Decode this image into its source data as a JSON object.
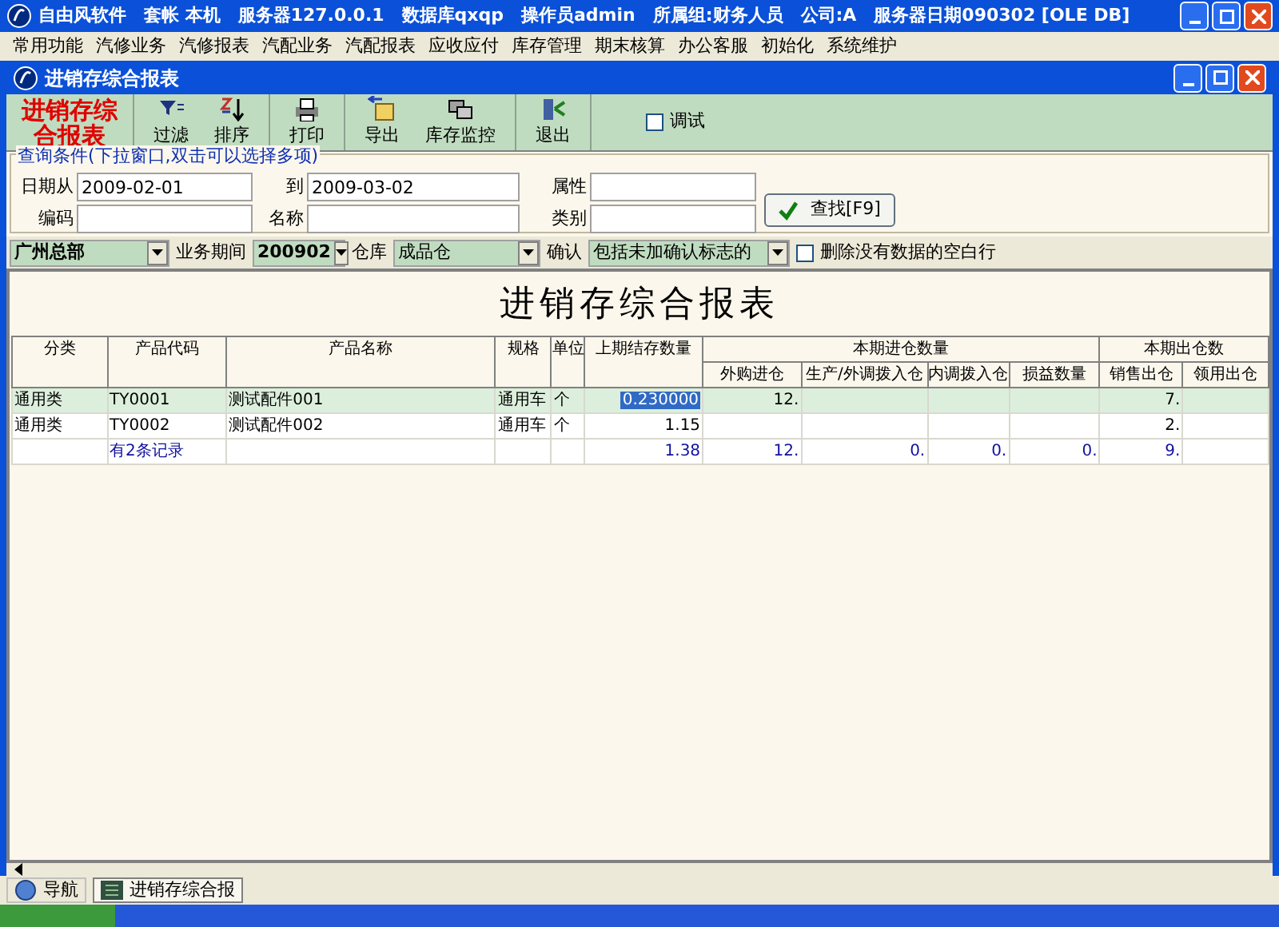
{
  "window": {
    "title": "自由风软件　套帐 本机　服务器127.0.0.1　数据库qxqp　操作员admin　所属组:财务人员　公司:A　服务器日期090302 [OLE DB]"
  },
  "menu": [
    "常用功能",
    "汽修业务",
    "汽修报表",
    "汽配业务",
    "汽配报表",
    "应收应付",
    "库存管理",
    "期末核算",
    "办公客服",
    "初始化",
    "系统维护"
  ],
  "child_window": {
    "title": "进销存综合报表"
  },
  "toolbar": {
    "title": "进销存综合报表",
    "buttons": [
      {
        "label": "过滤",
        "kind": "filter"
      },
      {
        "label": "排序",
        "kind": "sort"
      },
      {
        "label": "打印",
        "kind": "print"
      },
      {
        "label": "导出",
        "kind": "export"
      },
      {
        "label": "库存监控",
        "kind": "monitor"
      },
      {
        "label": "退出",
        "kind": "exit"
      }
    ],
    "debug": {
      "label": "调试",
      "checked": false
    }
  },
  "query": {
    "legend": "查询条件(下拉窗口,双击可以选择多项)",
    "fields": [
      {
        "label": "日期从",
        "value": "2009-02-01"
      },
      {
        "label": "到",
        "value": "2009-03-02"
      },
      {
        "label": "属性"
      },
      {
        "label": "编码"
      },
      {
        "label": "名称"
      },
      {
        "label": "类别"
      }
    ],
    "search_button": "查找[F9]"
  },
  "filters": {
    "branch": "广州总部",
    "period_label": "业务期间",
    "period": "200902",
    "warehouse_label": "仓库",
    "warehouse": "成品仓",
    "confirm_label": "确认",
    "confirm": "包括未加确认标志的",
    "remove_empty": {
      "label": "删除没有数据的空白行",
      "checked": false
    }
  },
  "report": {
    "title": "进销存综合报表",
    "headers": [
      {
        "label": "分类"
      },
      {
        "label": "产品代码"
      },
      {
        "label": "产品名称"
      },
      {
        "label": "规格"
      },
      {
        "label": "单位"
      },
      {
        "label": "上期结存数量"
      },
      {
        "group": "本期进仓数量",
        "subcolumns": [
          "外购进仓",
          "生产/外调拨入仓",
          "内调拨入仓",
          "损益数量"
        ]
      },
      {
        "group": "本期出仓数",
        "subcolumns": [
          "销售出仓",
          "领用出仓"
        ]
      }
    ],
    "rows": [
      {
        "kind": "item",
        "selected": true,
        "cells": [
          {
            "text": "通用类",
            "selected": false
          },
          {
            "text": "TY0001",
            "selected": false
          },
          {
            "text": "测试配件001",
            "selected": false
          },
          {
            "text": "通用车",
            "selected": false
          },
          {
            "text": "个",
            "selected": false
          },
          {
            "text": "0.230000",
            "selected": true
          },
          {
            "text": "12.",
            "selected": false
          },
          {
            "selected": false
          },
          {
            "selected": false
          },
          {
            "selected": false
          },
          {
            "text": "7.",
            "selected": false
          },
          {
            "selected": false
          }
        ]
      },
      {
        "kind": "item",
        "selected": false,
        "cells": [
          {
            "text": "通用类",
            "selected": false
          },
          {
            "text": "TY0002",
            "selected": false
          },
          {
            "text": "测试配件002",
            "selected": false
          },
          {
            "text": "通用车",
            "selected": false
          },
          {
            "text": "个",
            "selected": false
          },
          {
            "text": "1.15",
            "selected": false
          },
          {
            "selected": false
          },
          {
            "selected": false
          },
          {
            "selected": false
          },
          {
            "selected": false
          },
          {
            "text": "2.",
            "selected": false
          },
          {
            "selected": false
          }
        ]
      },
      {
        "kind": "total",
        "selected": false,
        "cells": [
          {
            "selected": false
          },
          {
            "text": "有2条记录",
            "selected": false
          },
          {
            "selected": false
          },
          {
            "selected": false
          },
          {
            "selected": false
          },
          {
            "text": "1.38",
            "selected": false
          },
          {
            "text": "12.",
            "selected": false
          },
          {
            "text": "0.",
            "selected": false
          },
          {
            "text": "0.",
            "selected": false
          },
          {
            "text": "0.",
            "selected": false
          },
          {
            "text": "9.",
            "selected": false
          },
          {
            "selected": false
          }
        ]
      }
    ]
  },
  "taskbar": [
    {
      "label": "导航",
      "kind": "nav",
      "selected": false
    },
    {
      "label": "进销存综合报",
      "kind": "report",
      "selected": true
    }
  ]
}
